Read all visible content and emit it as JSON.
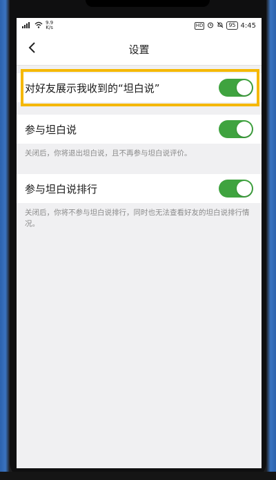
{
  "status_bar": {
    "signal": "⁴⁶",
    "speed_value": "9.9",
    "speed_unit": "K/s",
    "hd": "HD",
    "battery": "95",
    "time": "4:45"
  },
  "nav": {
    "title": "设置"
  },
  "settings": [
    {
      "label": "对好友展示我收到的“坦白说”",
      "enabled": true
    },
    {
      "label": "参与坦白说",
      "enabled": true,
      "description": "关闭后，你将退出坦白说，且不再参与坦白说评价。"
    },
    {
      "label": "参与坦白说排行",
      "enabled": true,
      "description": "关闭后，你将不参与坦白说排行，同时也无法查看好友的坦白说排行情况。"
    }
  ],
  "colors": {
    "toggle_on": "#3fa33f",
    "highlight": "#f5b800",
    "frame": "#2a5fa8"
  }
}
